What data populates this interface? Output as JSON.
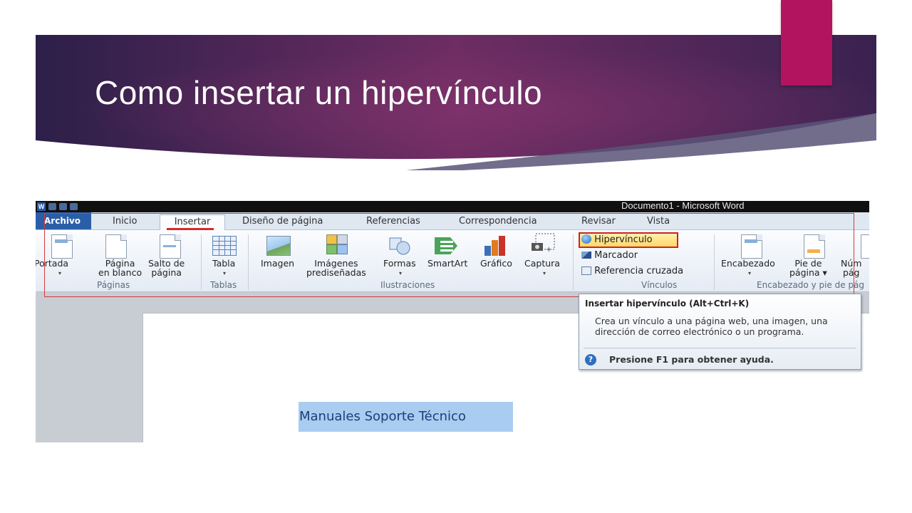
{
  "slide": {
    "title": "Como insertar un hipervínculo",
    "colors": {
      "banner_dark": "#2d1f4a",
      "banner_mid": "#6b2d63",
      "accent": "#b3145f"
    }
  },
  "word": {
    "window_title": "Documento1 - Microsoft Word",
    "tabs": {
      "file": "Archivo",
      "home": "Inicio",
      "insert": "Insertar",
      "page_design": "Diseño de página",
      "references": "Referencias",
      "mailings": "Correspondencia",
      "review": "Revisar",
      "view": "Vista"
    },
    "ribbon": {
      "paginas": {
        "label": "Páginas",
        "cover": "Portada",
        "blank_1": "Página",
        "blank_2": "en blanco",
        "break_1": "Salto de",
        "break_2": "página"
      },
      "tablas": {
        "label": "Tablas",
        "table": "Tabla"
      },
      "ilustraciones": {
        "label": "Ilustraciones",
        "image": "Imagen",
        "clipart_1": "Imágenes",
        "clipart_2": "prediseñadas",
        "shapes": "Formas",
        "smartart": "SmartArt",
        "chart": "Gráfico",
        "capture": "Captura"
      },
      "vinculos": {
        "label": "Vínculos",
        "hyperlink": "Hipervínculo",
        "bookmark": "Marcador",
        "crossref": "Referencia cruzada"
      },
      "encabezado": {
        "label": "Encabezado y pie de pág",
        "header": "Encabezado",
        "footer_1": "Pie de",
        "footer_2": "página ▾",
        "number_1": "Núm",
        "number_2": "pág"
      }
    },
    "document_text": "Manuales Soporte Técnico",
    "tooltip": {
      "title": "Insertar hipervínculo (Alt+Ctrl+K)",
      "body": "Crea un vínculo a una página web, una imagen, una dirección de correo electrónico o un programa.",
      "help": "Presione F1 para obtener ayuda."
    }
  }
}
